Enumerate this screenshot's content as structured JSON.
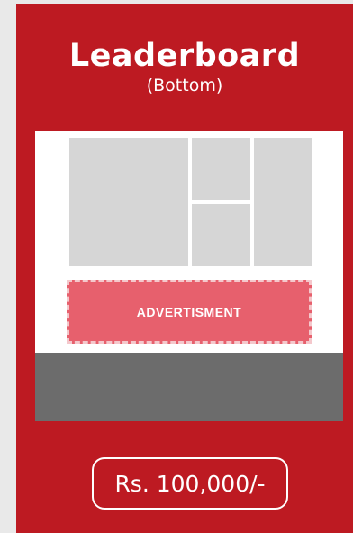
{
  "card": {
    "title": "Leaderboard",
    "subtitle": "(Bottom)",
    "ad_label": "ADVERTISMENT",
    "price": "Rs. 100,000/-"
  },
  "colors": {
    "card_background": "#bd1a22",
    "ad_background": "#e7606d",
    "placeholder_block": "#d6d6d6",
    "footer_bar": "#6c6c6c",
    "page_background": "#e9e9e9"
  }
}
